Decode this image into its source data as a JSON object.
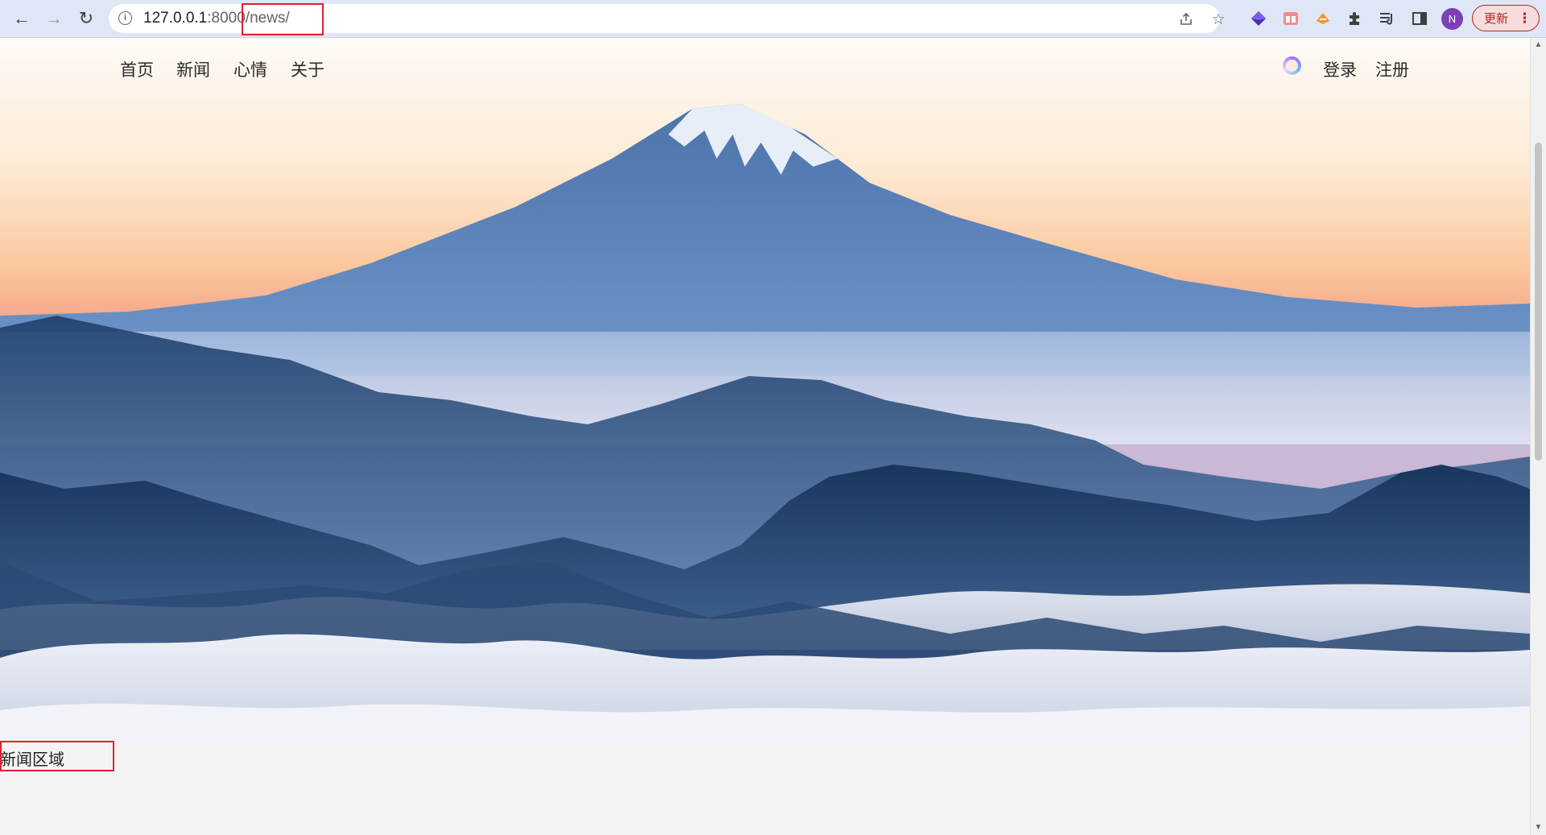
{
  "browser": {
    "url_host": "127.0.0.1",
    "url_port": ":8000",
    "url_path": "/news/",
    "update_label": "更新",
    "avatar_letter": "N",
    "profile_color": "#7b3fb8"
  },
  "site": {
    "nav_left": [
      "首页",
      "新闻",
      "心情",
      "关于"
    ],
    "login_label": "登录",
    "register_label": "注册"
  },
  "news": {
    "title": "新闻区域"
  },
  "icons": {
    "back": "back-arrow-icon",
    "forward": "forward-arrow-icon",
    "reload": "reload-icon",
    "info": "site-info-icon",
    "share": "share-icon",
    "bookmark": "star-icon",
    "extensions": "puzzle-icon",
    "media": "media-control-icon",
    "side_panel": "side-panel-icon",
    "loading": "loading-spinner-icon"
  }
}
